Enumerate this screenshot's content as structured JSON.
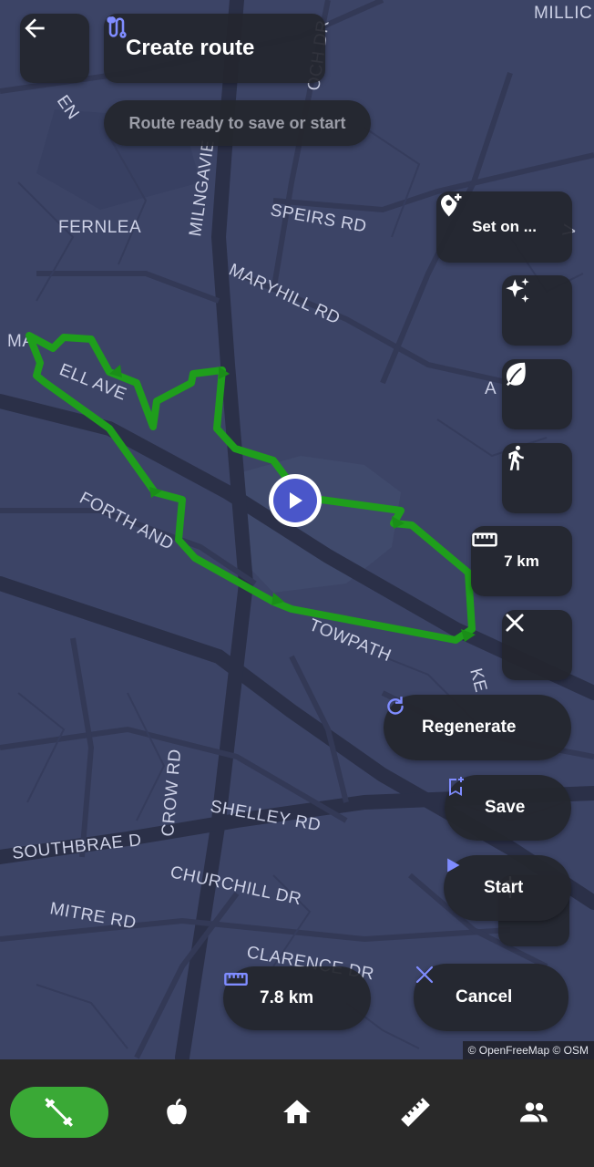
{
  "header": {
    "back_icon": "arrow-left-icon",
    "route_icon": "route-icon",
    "title": "Create route",
    "status": "Route ready to save or start"
  },
  "map": {
    "labels": {
      "fernlea": "FERNLEA",
      "speirs": "SPEIRS RD",
      "maryhill": "MARYHILL RD",
      "milngavie": "MILNGAVIE",
      "och": "OCH DR",
      "en": "EN",
      "ell_ave": "ELL AVE",
      "ma": "MA",
      "forth": "FORTH AND",
      "towpath": "TOWPATH",
      "ke": "KE",
      "crow": "CROW RD",
      "shelley": "SHELLEY RD",
      "southbrae": "SOUTHBRAE D",
      "churchill": "CHURCHILL DR",
      "mitre": "MITRE RD",
      "clarence": "CLARENCE DR",
      "milli": "MILLIC",
      "ai": "A",
      "v": "V"
    },
    "attribution": "© OpenFreeMap © OSM",
    "route_color": "#1f9e1c",
    "accent_color": "#4a56c9"
  },
  "controls": {
    "set_on": "Set on ...",
    "distance_option": "7 km"
  },
  "actions": {
    "regenerate": "Regenerate",
    "save": "Save",
    "start": "Start",
    "cancel": "Cancel",
    "route_distance": "7.8 km"
  },
  "nav": {
    "items": [
      "dumbbell-icon",
      "apple-icon",
      "home-icon",
      "ruler-icon",
      "people-icon"
    ],
    "active_color": "#3aa936"
  }
}
